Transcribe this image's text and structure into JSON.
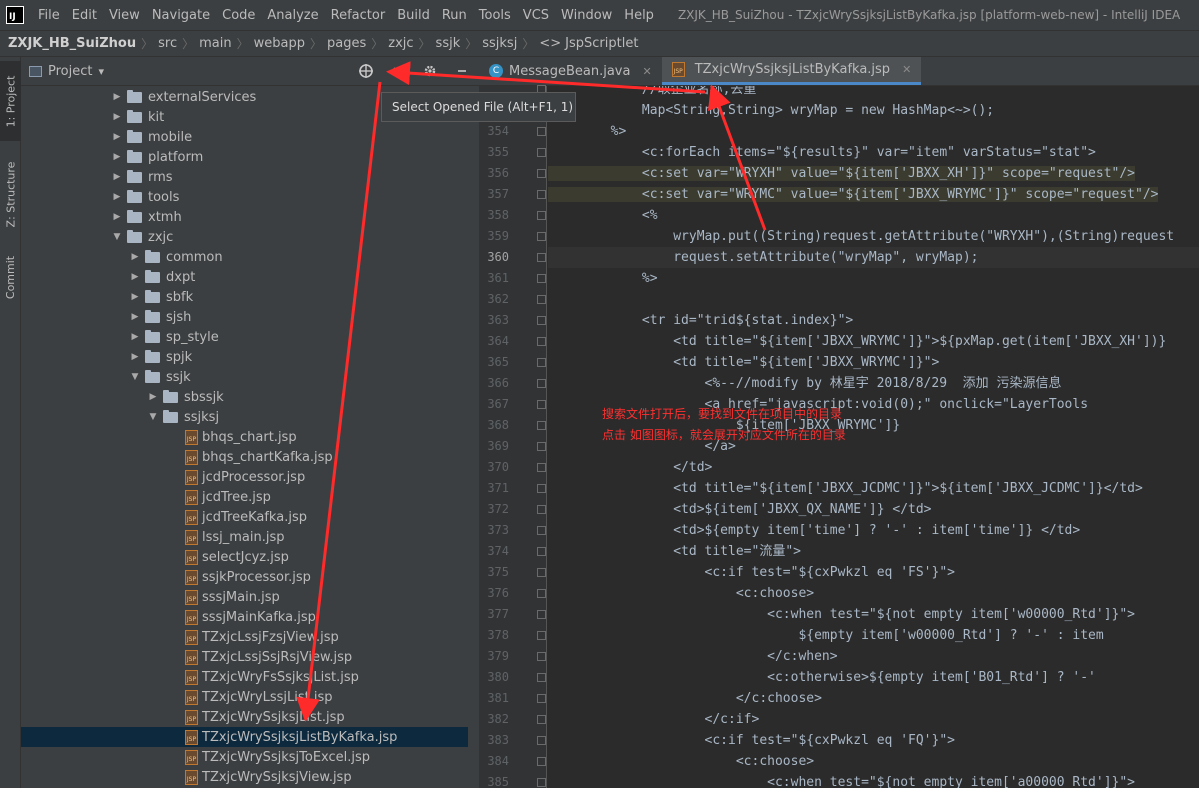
{
  "app": {
    "logo_text": "IJ",
    "window_title": "ZXJK_HB_SuiZhou - TZxjcWrySsjksjListByKafka.jsp [platform-web-new] - IntelliJ IDEA"
  },
  "menu": [
    "File",
    "Edit",
    "View",
    "Navigate",
    "Code",
    "Analyze",
    "Refactor",
    "Build",
    "Run",
    "Tools",
    "VCS",
    "Window",
    "Help"
  ],
  "breadcrumb": [
    "ZXJK_HB_SuiZhou",
    "src",
    "main",
    "webapp",
    "pages",
    "zxjc",
    "ssjk",
    "ssjksj",
    "JspScriptlet"
  ],
  "breadcrumb_scriptlet_prefix": "<>",
  "toolwindows": {
    "project": "1: Project",
    "structure": "Z: Structure",
    "commit": "Commit"
  },
  "project_panel": {
    "title": "Project",
    "dropdown": "▾",
    "tooltip": "Select Opened File (Alt+F1, 1)"
  },
  "tree": [
    {
      "label": "externalServices",
      "type": "folder",
      "depth": 0,
      "expanded": false
    },
    {
      "label": "kit",
      "type": "folder",
      "depth": 0,
      "expanded": false
    },
    {
      "label": "mobile",
      "type": "folder",
      "depth": 0,
      "expanded": false
    },
    {
      "label": "platform",
      "type": "folder",
      "depth": 0,
      "expanded": false
    },
    {
      "label": "rms",
      "type": "folder",
      "depth": 0,
      "expanded": false
    },
    {
      "label": "tools",
      "type": "folder",
      "depth": 0,
      "expanded": false
    },
    {
      "label": "xtmh",
      "type": "folder",
      "depth": 0,
      "expanded": false
    },
    {
      "label": "zxjc",
      "type": "folder",
      "depth": 0,
      "expanded": true
    },
    {
      "label": "common",
      "type": "folder",
      "depth": 1,
      "expanded": false
    },
    {
      "label": "dxpt",
      "type": "folder",
      "depth": 1,
      "expanded": false
    },
    {
      "label": "sbfk",
      "type": "folder",
      "depth": 1,
      "expanded": false
    },
    {
      "label": "sjsh",
      "type": "folder",
      "depth": 1,
      "expanded": false
    },
    {
      "label": "sp_style",
      "type": "folder",
      "depth": 1,
      "expanded": false
    },
    {
      "label": "spjk",
      "type": "folder",
      "depth": 1,
      "expanded": false
    },
    {
      "label": "ssjk",
      "type": "folder",
      "depth": 1,
      "expanded": true
    },
    {
      "label": "sbssjk",
      "type": "folder",
      "depth": 2,
      "expanded": false
    },
    {
      "label": "ssjksj",
      "type": "folder",
      "depth": 2,
      "expanded": true
    },
    {
      "label": "bhqs_chart.jsp",
      "type": "jsp",
      "depth": 3
    },
    {
      "label": "bhqs_chartKafka.jsp",
      "type": "jsp",
      "depth": 3
    },
    {
      "label": "jcdProcessor.jsp",
      "type": "jsp",
      "depth": 3
    },
    {
      "label": "jcdTree.jsp",
      "type": "jsp",
      "depth": 3
    },
    {
      "label": "jcdTreeKafka.jsp",
      "type": "jsp",
      "depth": 3
    },
    {
      "label": "lssj_main.jsp",
      "type": "jsp",
      "depth": 3
    },
    {
      "label": "selectJcyz.jsp",
      "type": "jsp",
      "depth": 3
    },
    {
      "label": "ssjkProcessor.jsp",
      "type": "jsp",
      "depth": 3
    },
    {
      "label": "sssjMain.jsp",
      "type": "jsp",
      "depth": 3
    },
    {
      "label": "sssjMainKafka.jsp",
      "type": "jsp",
      "depth": 3
    },
    {
      "label": "TZxjcLssjFzsjView.jsp",
      "type": "jsp",
      "depth": 3
    },
    {
      "label": "TZxjcLssjSsjRsjView.jsp",
      "type": "jsp",
      "depth": 3
    },
    {
      "label": "TZxjcWryFsSsjksjList.jsp",
      "type": "jsp",
      "depth": 3
    },
    {
      "label": "TZxjcWryLssjList.jsp",
      "type": "jsp",
      "depth": 3
    },
    {
      "label": "TZxjcWrySsjksjList.jsp",
      "type": "jsp",
      "depth": 3
    },
    {
      "label": "TZxjcWrySsjksjListByKafka.jsp",
      "type": "jsp",
      "depth": 3,
      "selected": true
    },
    {
      "label": "TZxjcWrySsjksjToExcel.jsp",
      "type": "jsp",
      "depth": 3
    },
    {
      "label": "TZxjcWrySsjksjView.jsp",
      "type": "jsp",
      "depth": 3
    }
  ],
  "editor_tabs": [
    {
      "label": "MessageBean.java",
      "icon": "c",
      "active": false
    },
    {
      "label": "TZxjcWrySsjksjListByKafka.jsp",
      "icon": "jsp",
      "active": true
    }
  ],
  "code_lines": [
    {
      "n": "",
      "t": "            //取企业名称,去重"
    },
    {
      "n": "",
      "t": "            Map<String,String> wryMap = new HashMap<~>();"
    },
    {
      "n": "354",
      "t": "        %>"
    },
    {
      "n": "355",
      "t": "            <c:forEach items=\"${results}\" var=\"item\" varStatus=\"stat\">"
    },
    {
      "n": "356",
      "t": "            <c:set var=\"WRYXH\" value=\"${item['JBXX_XH']}\" scope=\"request\"/>",
      "hl": true
    },
    {
      "n": "357",
      "t": "            <c:set var=\"WRYMC\" value=\"${item['JBXX_WRYMC']}\" scope=\"request\"/>",
      "hl": true
    },
    {
      "n": "358",
      "t": "            <%"
    },
    {
      "n": "359",
      "t": "                wryMap.put((String)request.getAttribute(\"WRYXH\"),(String)request"
    },
    {
      "n": "360",
      "t": "                request.setAttribute(\"wryMap\", wryMap);",
      "cur": true
    },
    {
      "n": "361",
      "t": "            %>"
    },
    {
      "n": "362",
      "t": ""
    },
    {
      "n": "363",
      "t": "            <tr id=\"trid${stat.index}\">"
    },
    {
      "n": "364",
      "t": "                <td title=\"${item['JBXX_WRYMC']}\">${pxMap.get(item['JBXX_XH'])}"
    },
    {
      "n": "365",
      "t": "                <td title=\"${item['JBXX_WRYMC']}\">"
    },
    {
      "n": "366",
      "t": "                    <%--//modify by 林星宇 2018/8/29  添加 污染源信息"
    },
    {
      "n": "367",
      "t": "                    <a href=\"javascript:void(0);\" onclick=\"LayerTools"
    },
    {
      "n": "368",
      "t": "                        ${item['JBXX_WRYMC']}"
    },
    {
      "n": "369",
      "t": "                    </a>"
    },
    {
      "n": "370",
      "t": "                </td>"
    },
    {
      "n": "371",
      "t": "                <td title=\"${item['JBXX_JCDMC']}\">${item['JBXX_JCDMC']}</td>"
    },
    {
      "n": "372",
      "t": "                <td>${item['JBXX_QX_NAME']} </td>"
    },
    {
      "n": "373",
      "t": "                <td>${empty item['time'] ? '-' : item['time']} </td>"
    },
    {
      "n": "374",
      "t": "                <td title=\"流量\">"
    },
    {
      "n": "375",
      "t": "                    <c:if test=\"${cxPwkzl eq 'FS'}\">"
    },
    {
      "n": "376",
      "t": "                        <c:choose>"
    },
    {
      "n": "377",
      "t": "                            <c:when test=\"${not empty item['w00000_Rtd']}\">"
    },
    {
      "n": "378",
      "t": "                                ${empty item['w00000_Rtd'] ? '-' : item"
    },
    {
      "n": "379",
      "t": "                            </c:when>"
    },
    {
      "n": "380",
      "t": "                            <c:otherwise>${empty item['B01_Rtd'] ? '-'"
    },
    {
      "n": "381",
      "t": "                        </c:choose>"
    },
    {
      "n": "382",
      "t": "                    </c:if>"
    },
    {
      "n": "383",
      "t": "                    <c:if test=\"${cxPwkzl eq 'FQ'}\">"
    },
    {
      "n": "384",
      "t": "                        <c:choose>"
    },
    {
      "n": "385",
      "t": "                            <c:when test=\"${not empty item['a00000_Rtd']}\">"
    }
  ],
  "annotation": {
    "line1": "搜索文件打开后，要找到文件在项目中的目录",
    "line2": "点击 如图图标，就会展开对应文件所在的目录"
  },
  "colors": {
    "annotation": "#ff3030",
    "selection": "#0d293e",
    "accent": "#4a88c7"
  }
}
